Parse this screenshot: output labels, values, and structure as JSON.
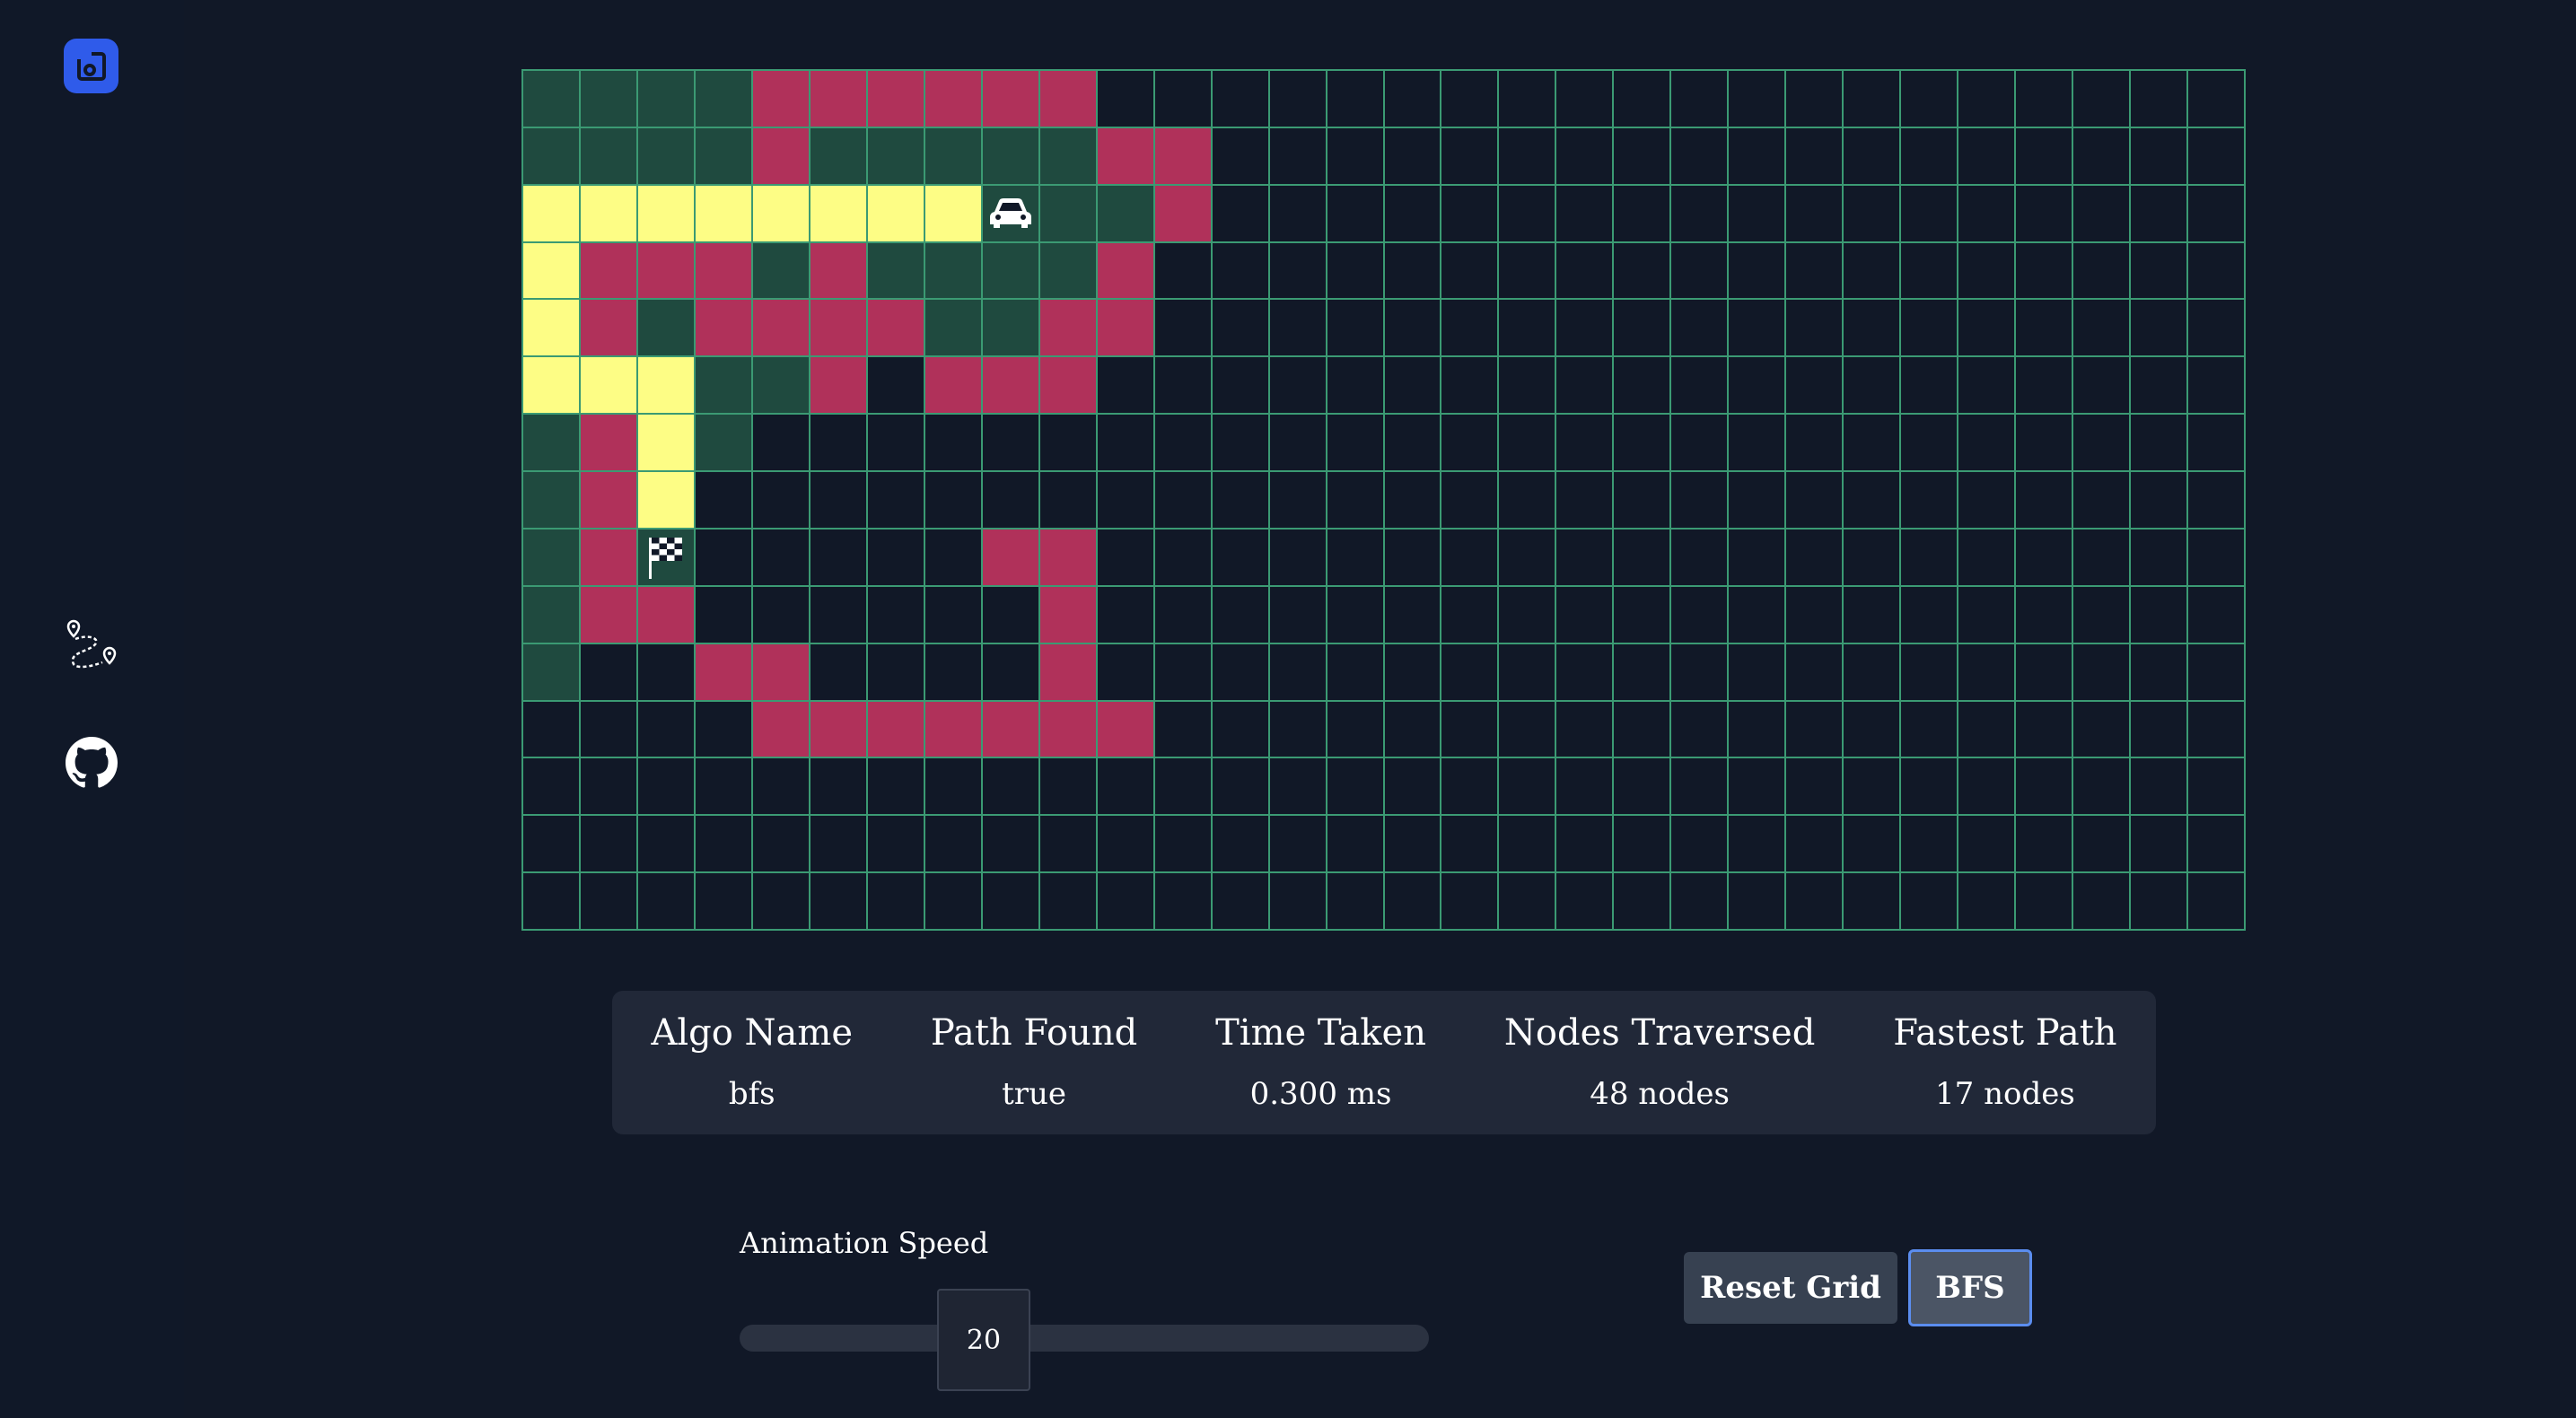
{
  "sidebar": {
    "logo_icon": "app-logo-icon",
    "nav_icons": [
      "route-map-icon",
      "github-icon"
    ]
  },
  "grid": {
    "columns": 30,
    "rows": 15,
    "legend": {
      "v": "visited",
      "w": "wall",
      "p": "path",
      "e": "empty"
    },
    "colors": {
      "visited": "#1f4a3f",
      "wall": "#b0315a",
      "path": "#fdfd85",
      "empty": "#111827",
      "border": "#3b9a73"
    },
    "start": {
      "row": 2,
      "col": 8,
      "icon": "car-icon"
    },
    "target": {
      "row": 8,
      "col": 2,
      "icon": "checkered-flag-icon"
    },
    "cells": [
      "vvvvwwwwwwee..................",
      "vvvvwvvvvvww..................",
      "ppppppppvvvw..................",
      "pwwwvwvvvvw...................",
      "pwvwwwwvvww...................",
      "pppvvwewwwe...................",
      "vwpv..........................",
      "vwp...........................",
      "vwv.....ww....................",
      "vww......w....................",
      "v..ww....w....................",
      "....wwwwwww...................",
      "..............................",
      "..............................",
      ".............................."
    ]
  },
  "stats": [
    {
      "label": "Algo Name",
      "value": "bfs"
    },
    {
      "label": "Path Found",
      "value": "true"
    },
    {
      "label": "Time Taken",
      "value": "0.300 ms"
    },
    {
      "label": "Nodes Traversed",
      "value": "48 nodes"
    },
    {
      "label": "Fastest Path",
      "value": "17 nodes"
    }
  ],
  "controls": {
    "speed_label": "Animation Speed",
    "speed_value": "20",
    "reset_label": "Reset Grid",
    "algo_label": "BFS"
  }
}
